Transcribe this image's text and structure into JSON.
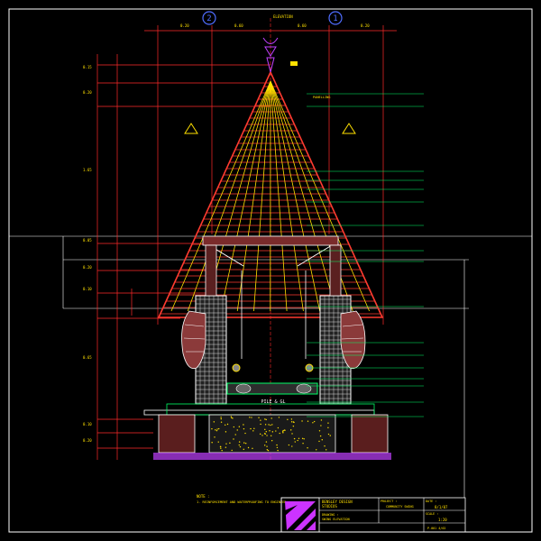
{
  "grid_bubbles": [
    "2",
    "1"
  ],
  "top_center_label": "ELEVATION",
  "center_label": "PILE & GL",
  "apex_note": "PANELLING",
  "notes": {
    "heading": "NOTE :",
    "line1": "1. REINFORCEMENT AND WATERPROOFING TO ENGINEER"
  },
  "title_block": {
    "studio_name": "BENSLEY DESIGN",
    "studio_sub": "STUDIOS",
    "project_label": "PROJECT :",
    "project_value": "COMMUNITY SWING",
    "drawing_label": "DRAWING :",
    "drawing_value": "SWING ELEVATION",
    "scale_label": "SCALE :",
    "scale_value": "1:20",
    "date_label": "DATE :",
    "date_value": "8/1/07",
    "sheet_no": "P-001 4/02"
  },
  "colors": {
    "background": "#000000",
    "roof_line": "#ff3b30",
    "rafter": "#ffe000",
    "dimension": "#ff2a2a",
    "leader": "#00ff66",
    "pillar": "#ffffff",
    "hand": "#8b3a3a",
    "logo": "#cc33ff"
  }
}
